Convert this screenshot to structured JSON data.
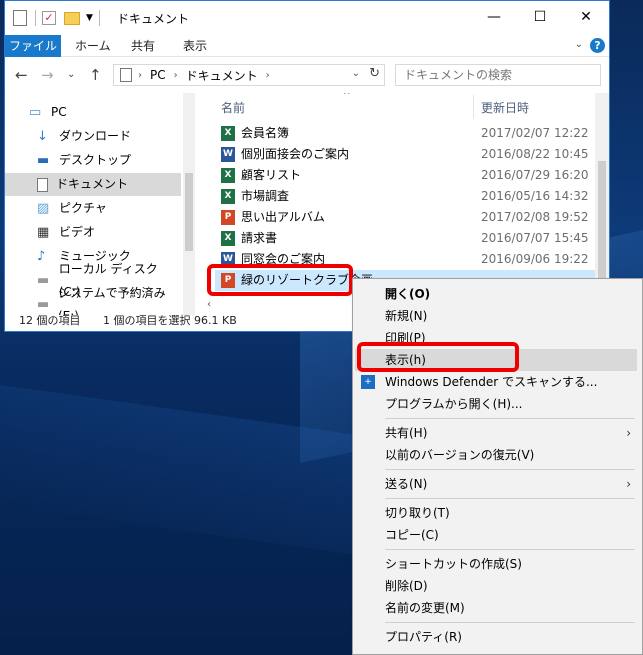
{
  "window": {
    "title": "ドキュメント",
    "controls": {
      "minimize": "—",
      "maximize": "☐",
      "close": "✕"
    }
  },
  "ribbon": {
    "file": "ファイル",
    "tabs": [
      "ホーム",
      "共有",
      "表示"
    ],
    "help": "?"
  },
  "address": {
    "crumbs": [
      "PC",
      "ドキュメント"
    ],
    "search_placeholder": "ドキュメントの検索"
  },
  "nav": {
    "items": [
      {
        "label": "PC",
        "icon": "pc-icon"
      },
      {
        "label": "ダウンロード",
        "icon": "download-icon"
      },
      {
        "label": "デスクトップ",
        "icon": "desktop-icon"
      },
      {
        "label": "ドキュメント",
        "icon": "documents-icon",
        "selected": true
      },
      {
        "label": "ピクチャ",
        "icon": "pictures-icon"
      },
      {
        "label": "ビデオ",
        "icon": "video-icon"
      },
      {
        "label": "ミュージック",
        "icon": "music-icon"
      },
      {
        "label": "ローカル ディスク (C:)",
        "icon": "drive-icon"
      },
      {
        "label": "システムで予約済み (E:)",
        "icon": "drive-icon"
      }
    ]
  },
  "files": {
    "headers": {
      "name": "名前",
      "date": "更新日時"
    },
    "rows": [
      {
        "name": "会員名簿",
        "date": "2017/02/07 12:22",
        "type": "excel"
      },
      {
        "name": "個別面接会のご案内",
        "date": "2016/08/22 10:45",
        "type": "word"
      },
      {
        "name": "顧客リスト",
        "date": "2016/07/29 16:20",
        "type": "excel"
      },
      {
        "name": "市場調査",
        "date": "2016/05/16 14:32",
        "type": "excel"
      },
      {
        "name": "思い出アルバム",
        "date": "2017/02/08 19:52",
        "type": "powerpoint"
      },
      {
        "name": "請求書",
        "date": "2016/07/07 15:45",
        "type": "excel"
      },
      {
        "name": "同窓会のご案内",
        "date": "2016/09/06 19:22",
        "type": "word"
      },
      {
        "name": "緑のリゾートクラブ企画",
        "date": "",
        "type": "powerpoint",
        "selected": true
      }
    ],
    "type_colors": {
      "excel": "#1e7145",
      "word": "#2b579a",
      "powerpoint": "#d24726"
    },
    "type_letters": {
      "excel": "X",
      "word": "W",
      "powerpoint": "P"
    }
  },
  "status": {
    "count": "12 個の項目",
    "selection": "1 個の項目を選択  96.1 KB"
  },
  "context_menu": {
    "groups": [
      [
        {
          "label": "開く(O)",
          "bold": true
        },
        {
          "label": "新規(N)"
        },
        {
          "label": "印刷(P)"
        },
        {
          "label": "表示(h)",
          "hover": true
        },
        {
          "label": "Windows Defender でスキャンする...",
          "icon": "shield-icon"
        },
        {
          "label": "プログラムから開く(H)..."
        }
      ],
      [
        {
          "label": "共有(H)",
          "submenu": true
        },
        {
          "label": "以前のバージョンの復元(V)"
        }
      ],
      [
        {
          "label": "送る(N)",
          "submenu": true
        }
      ],
      [
        {
          "label": "切り取り(T)"
        },
        {
          "label": "コピー(C)"
        }
      ],
      [
        {
          "label": "ショートカットの作成(S)"
        },
        {
          "label": "削除(D)"
        },
        {
          "label": "名前の変更(M)"
        }
      ],
      [
        {
          "label": "プロパティ(R)"
        }
      ]
    ]
  },
  "colors": {
    "accent": "#1979ca",
    "highlight": "#e00000",
    "selection": "#cce8ff"
  }
}
